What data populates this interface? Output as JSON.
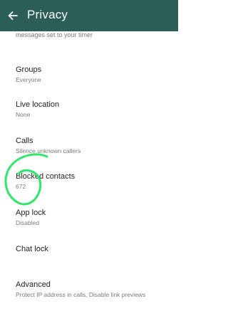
{
  "header": {
    "title": "Privacy",
    "back_icon": "arrow-left-icon",
    "background_color": "#2b5f55"
  },
  "partial_row_text": "messages set to your timer",
  "items": [
    {
      "title": "Groups",
      "subtitle": "Everyone"
    },
    {
      "title": "Live location",
      "subtitle": "None"
    },
    {
      "title": "Calls",
      "subtitle": "Silence unknown callers"
    },
    {
      "title": "Blocked contacts",
      "subtitle": "672"
    },
    {
      "title": "App lock",
      "subtitle": "Disabled"
    },
    {
      "title": "Chat lock",
      "subtitle": ""
    },
    {
      "title": "Advanced",
      "subtitle": "Protect IP address in calls, Disable link previews"
    }
  ],
  "annotation": {
    "shape": "hand-drawn circle around Blocked contacts",
    "color": "#2ee86a"
  }
}
